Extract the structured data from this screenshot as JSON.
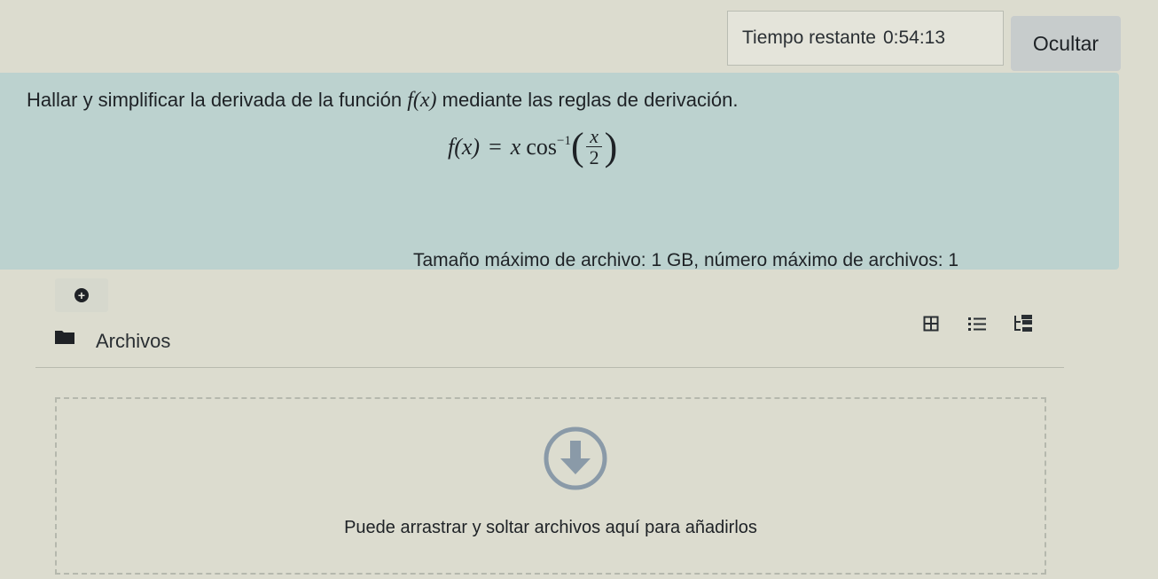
{
  "timer": {
    "label": "Tiempo restante",
    "value": "0:54:13",
    "hide_label": "Ocultar"
  },
  "question": {
    "text_before": "Hallar y simplificar la derivada de la función",
    "function_ref": "f(x)",
    "text_after": "mediante las reglas de derivación.",
    "formula": {
      "lhs": "f(x)",
      "equals": "=",
      "factor": "x",
      "func": "cos",
      "exponent": "−1",
      "numerator": "x",
      "denominator": "2"
    }
  },
  "upload": {
    "limits_text": "Tamaño máximo de archivo: 1 GB, número máximo de archivos: 1",
    "add_icon": "plus-circle-icon",
    "folder_label": "Archivos",
    "views": [
      "grid-view-icon",
      "list-view-icon",
      "tree-view-icon"
    ],
    "dropzone_text": "Puede arrastrar y soltar archivos aquí para añadirlos",
    "drop_icon": "download-arrow-icon"
  },
  "colors": {
    "page_bg": "#dcdccf",
    "question_bg": "#bcd2cf",
    "hide_button_bg": "#c7cccc",
    "drop_icon": "#8a9aa8"
  }
}
